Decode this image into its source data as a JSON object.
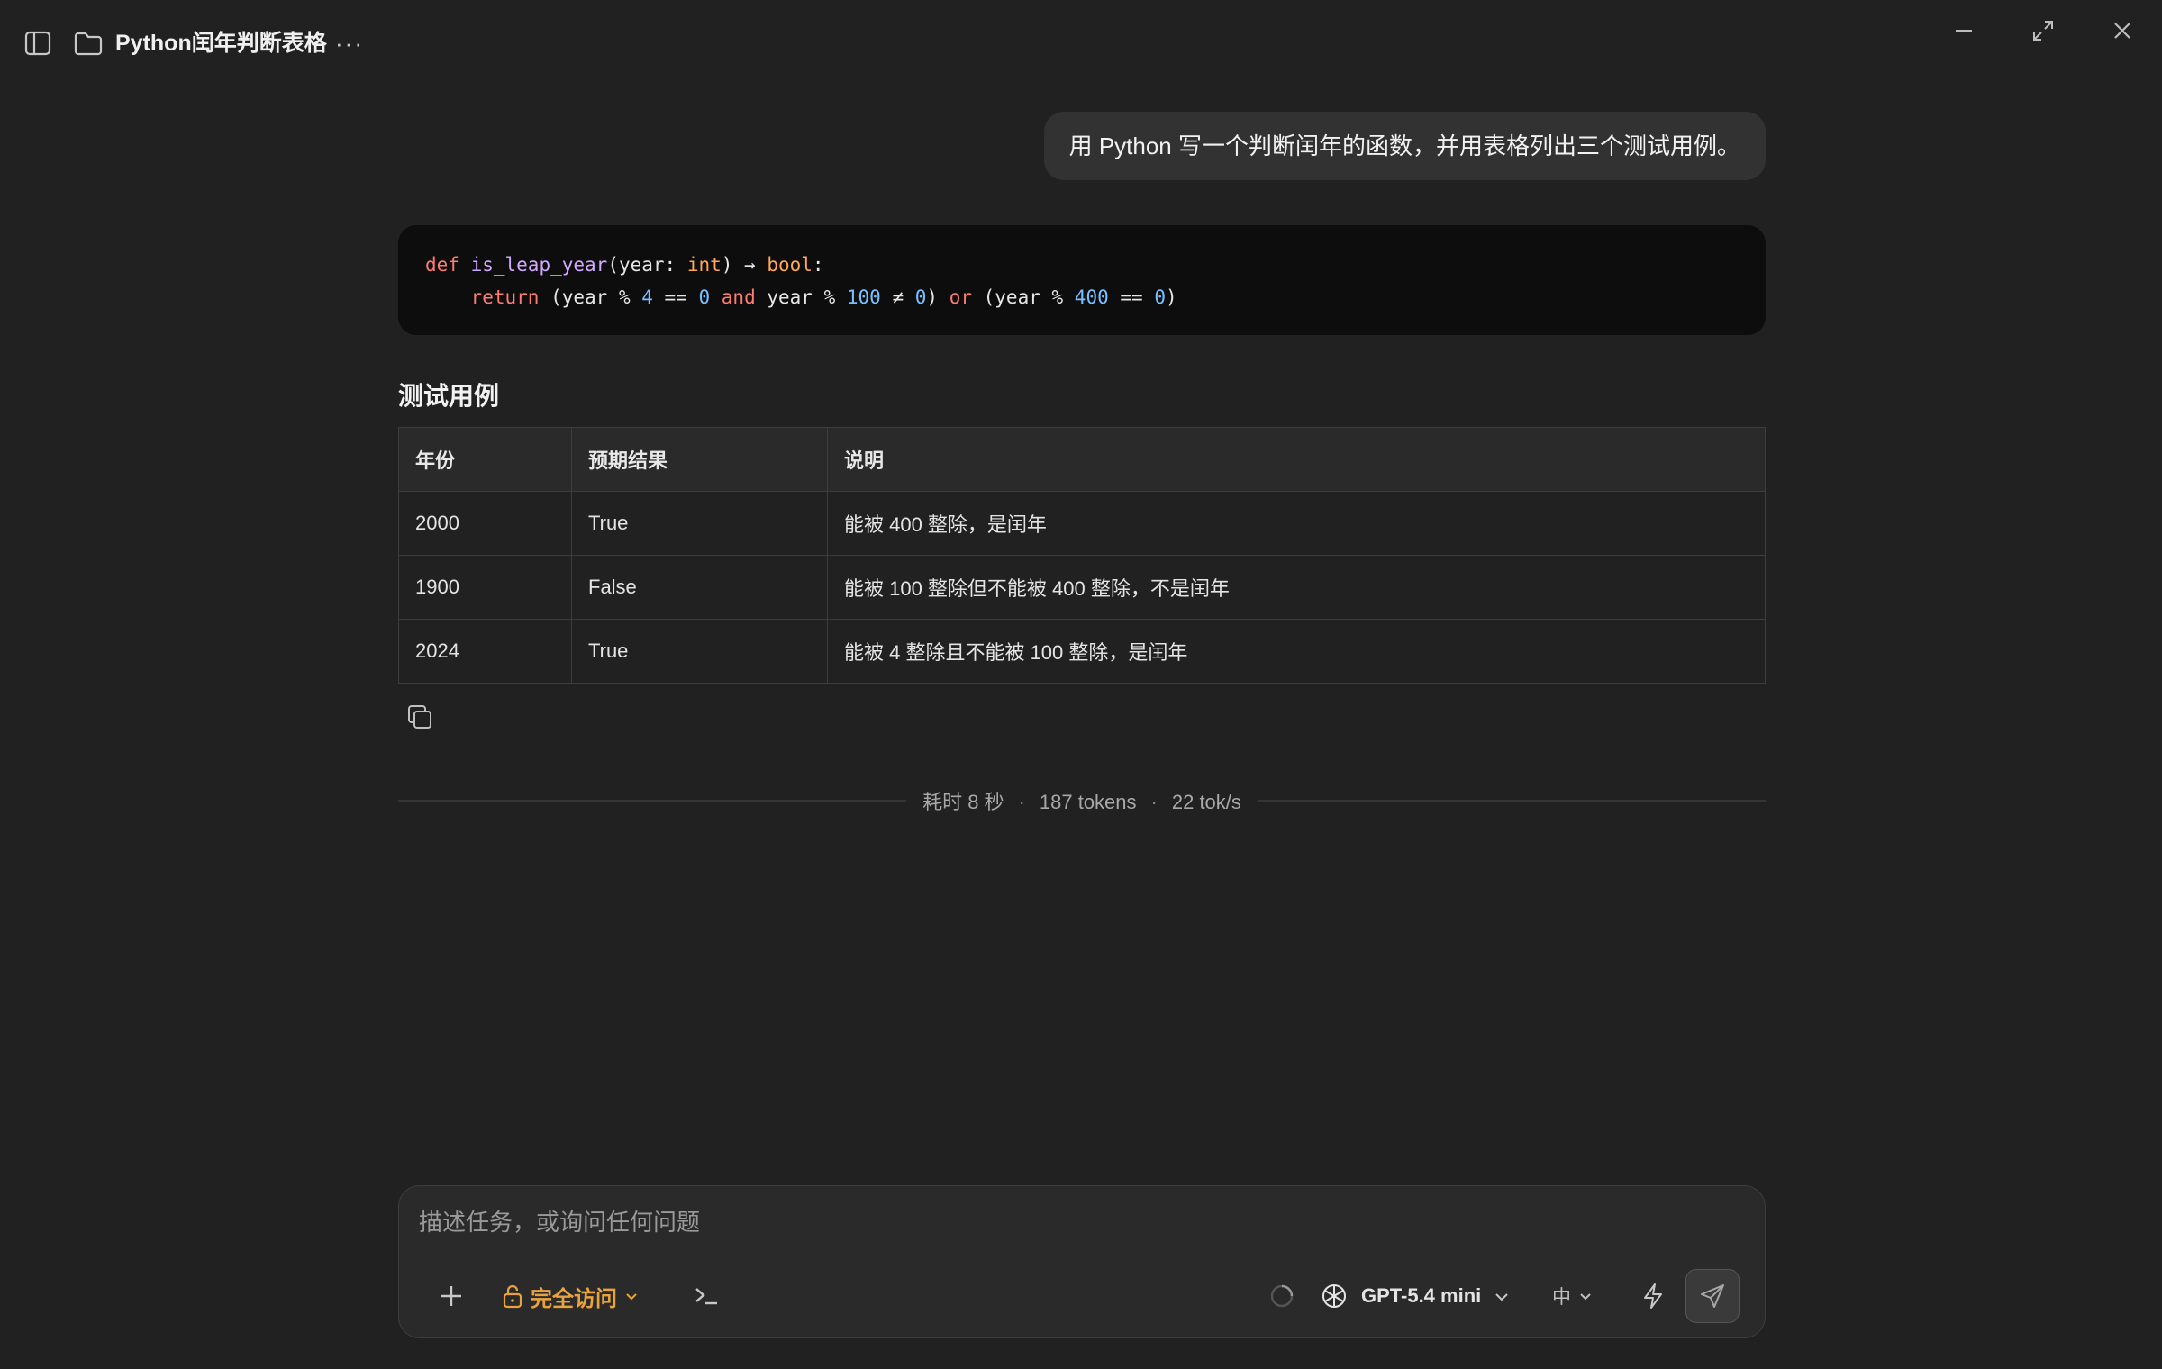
{
  "window": {
    "title": "Python闰年判断表格",
    "more_label": "···"
  },
  "chat": {
    "user_message": "用 Python 写一个判断闰年的函数，并用表格列出三个测试用例。",
    "code": {
      "line1": {
        "kw": "def",
        "fn": "is_leap_year",
        "arg": "(year: ",
        "type1": "int",
        "arrow": ") → ",
        "type2": "bool",
        "end": ":"
      },
      "line2": {
        "kw_return": "return",
        "p1": " (year % ",
        "n4": "4",
        "p2": " == ",
        "n0a": "0",
        "kw_and": "and",
        "p3": " year % ",
        "n100": "100",
        "p4": " ≠ ",
        "n0b": "0",
        "p5": ") ",
        "kw_or": "or",
        "p6": " (year % ",
        "n400": "400",
        "p7": " == ",
        "n0c": "0",
        "p8": ")"
      }
    },
    "section_title": "测试用例",
    "table": {
      "headers": [
        "年份",
        "预期结果",
        "说明"
      ],
      "rows": [
        [
          "2000",
          "True",
          "能被 400 整除，是闰年"
        ],
        [
          "1900",
          "False",
          "能被 100 整除但不能被 400 整除，不是闰年"
        ],
        [
          "2024",
          "True",
          "能被 4 整除且不能被 100 整除，是闰年"
        ]
      ]
    },
    "stats": {
      "time": "耗时 8 秒",
      "tokens": "187 tokens",
      "speed": "22 tok/s",
      "separator": "·"
    }
  },
  "composer": {
    "placeholder": "描述任务，或询问任何问题",
    "access_label": "完全访问",
    "model_label": "GPT-5.4 mini",
    "lang_label": "中"
  },
  "colors": {
    "background": "#212121",
    "code_bg": "#0d0d0d",
    "access_accent": "#e8a33d",
    "keyword": "#ff7b72",
    "function": "#d2a8ff",
    "type": "#ffa657",
    "number": "#79c0ff"
  },
  "icons": [
    "sidebar-toggle-icon",
    "folder-icon",
    "more-icon",
    "minimize-icon",
    "maximize-icon",
    "close-icon",
    "copy-icon",
    "plus-icon",
    "lock-icon",
    "chevron-down-icon",
    "terminal-icon",
    "spinner-icon",
    "openai-icon",
    "flash-icon",
    "send-icon"
  ]
}
